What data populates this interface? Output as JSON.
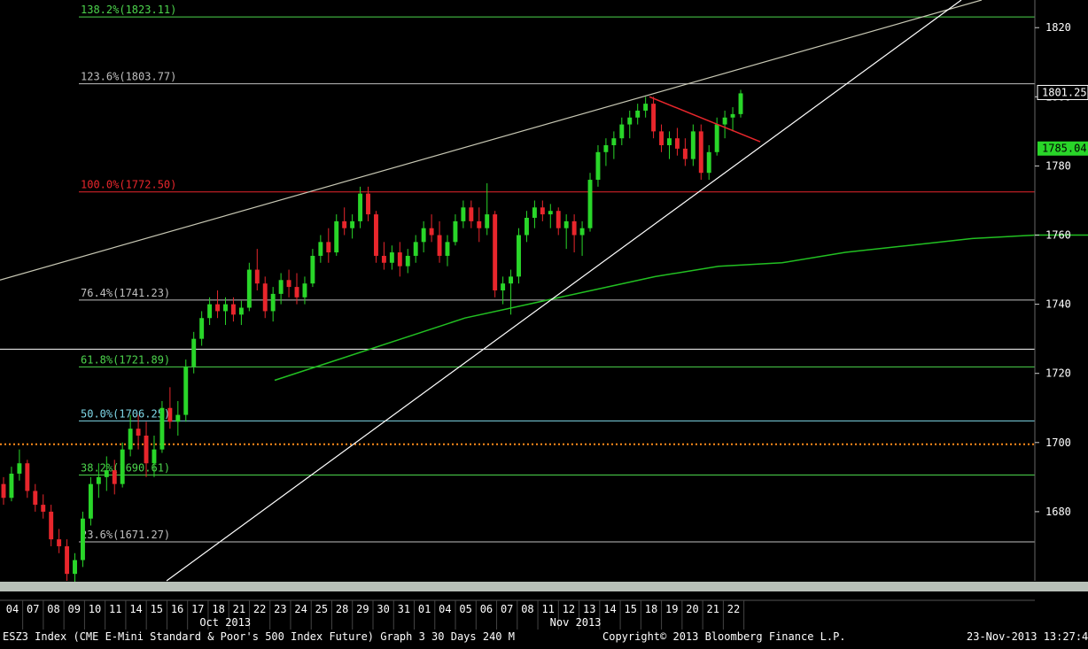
{
  "chart_data": {
    "type": "candlestick",
    "ylim": [
      1660,
      1828
    ],
    "y_ticks": [
      "1680",
      "1700",
      "1720",
      "1740",
      "1760",
      "1780",
      "1800",
      "1820"
    ],
    "grid": false,
    "x_dates": [
      "04",
      "07",
      "08",
      "09",
      "10",
      "11",
      "14",
      "15",
      "16",
      "17",
      "18",
      "21",
      "22",
      "23",
      "24",
      "25",
      "28",
      "29",
      "30",
      "31",
      "01",
      "04",
      "05",
      "06",
      "07",
      "08",
      "11",
      "12",
      "13",
      "14",
      "15",
      "18",
      "19",
      "20",
      "21",
      "22"
    ],
    "month_labels": [
      {
        "label": "Oct 2013",
        "start_index": 9
      },
      {
        "label": "Nov 2013",
        "start_index": 26
      }
    ],
    "fib_levels": [
      {
        "label": "138.2%(1823.11)",
        "value": 1823.11,
        "color": "#4cd44c"
      },
      {
        "label": "123.6%(1803.77)",
        "value": 1803.77,
        "color": "#bfbfbf"
      },
      {
        "label": "100.0%(1772.50)",
        "value": 1772.5,
        "color": "#e8262c"
      },
      {
        "label": "76.4%(1741.23)",
        "value": 1741.23,
        "color": "#bfbfbf"
      },
      {
        "label": "61.8%(1721.89)",
        "value": 1721.89,
        "color": "#4cd44c"
      },
      {
        "label": "50.0%(1706.25)",
        "value": 1706.25,
        "color": "#7fd8e8"
      },
      {
        "label": "38.2%(1690.61)",
        "value": 1690.61,
        "color": "#4cd44c"
      },
      {
        "label": "23.6%(1671.27)",
        "value": 1671.27,
        "color": "#bfbfbf"
      }
    ],
    "horizontal_levels": [
      {
        "value": 1727,
        "color": "#ffffff",
        "style": "solid"
      },
      {
        "value": 1699.5,
        "color": "#ff8c1a",
        "style": "dotted"
      }
    ],
    "current_price": {
      "label": "1801.25",
      "value": 1801.25
    },
    "moving_average_value": {
      "label": "1785.04",
      "value": 1785.04
    },
    "colors": {
      "up": "#29d629",
      "down": "#e8262c",
      "ma": "#22c022",
      "trend": "#ffffff",
      "channel": "#c8c8b4",
      "wedge": "#e8262c"
    },
    "candles": [
      [
        1688,
        1690,
        1682,
        1684
      ],
      [
        1684,
        1693,
        1683,
        1691
      ],
      [
        1691,
        1698,
        1689,
        1694
      ],
      [
        1694,
        1695,
        1684,
        1686
      ],
      [
        1686,
        1688,
        1680,
        1682
      ],
      [
        1682,
        1685,
        1678,
        1680
      ],
      [
        1680,
        1682,
        1670,
        1672
      ],
      [
        1672,
        1675,
        1668,
        1670
      ],
      [
        1670,
        1672,
        1660,
        1662
      ],
      [
        1662,
        1668,
        1658,
        1666
      ],
      [
        1666,
        1680,
        1664,
        1678
      ],
      [
        1678,
        1690,
        1676,
        1688
      ],
      [
        1688,
        1694,
        1684,
        1690
      ],
      [
        1690,
        1696,
        1686,
        1692
      ],
      [
        1692,
        1695,
        1685,
        1688
      ],
      [
        1688,
        1700,
        1687,
        1698
      ],
      [
        1698,
        1708,
        1696,
        1704
      ],
      [
        1704,
        1708,
        1698,
        1702
      ],
      [
        1702,
        1706,
        1690,
        1694
      ],
      [
        1694,
        1702,
        1690,
        1698
      ],
      [
        1698,
        1712,
        1697,
        1710
      ],
      [
        1710,
        1716,
        1704,
        1706
      ],
      [
        1706,
        1712,
        1702,
        1708
      ],
      [
        1708,
        1724,
        1706,
        1722
      ],
      [
        1722,
        1732,
        1720,
        1730
      ],
      [
        1730,
        1738,
        1728,
        1736
      ],
      [
        1736,
        1742,
        1734,
        1740
      ],
      [
        1740,
        1744,
        1736,
        1738
      ],
      [
        1738,
        1742,
        1734,
        1740
      ],
      [
        1740,
        1742,
        1735,
        1737
      ],
      [
        1737,
        1741,
        1734,
        1739
      ],
      [
        1739,
        1752,
        1738,
        1750
      ],
      [
        1750,
        1756,
        1744,
        1746
      ],
      [
        1746,
        1748,
        1736,
        1738
      ],
      [
        1738,
        1745,
        1735,
        1743
      ],
      [
        1743,
        1749,
        1740,
        1747
      ],
      [
        1747,
        1750,
        1742,
        1745
      ],
      [
        1745,
        1749,
        1740,
        1742
      ],
      [
        1742,
        1748,
        1740,
        1746
      ],
      [
        1746,
        1756,
        1745,
        1754
      ],
      [
        1754,
        1760,
        1752,
        1758
      ],
      [
        1758,
        1762,
        1752,
        1755
      ],
      [
        1755,
        1766,
        1754,
        1764
      ],
      [
        1764,
        1768,
        1760,
        1762
      ],
      [
        1762,
        1766,
        1759,
        1764
      ],
      [
        1764,
        1774,
        1762,
        1772
      ],
      [
        1772,
        1774,
        1764,
        1766
      ],
      [
        1766,
        1767,
        1752,
        1754
      ],
      [
        1754,
        1758,
        1750,
        1752
      ],
      [
        1752,
        1757,
        1750,
        1755
      ],
      [
        1755,
        1758,
        1748,
        1751
      ],
      [
        1751,
        1756,
        1749,
        1754
      ],
      [
        1754,
        1760,
        1752,
        1758
      ],
      [
        1758,
        1764,
        1755,
        1762
      ],
      [
        1762,
        1766,
        1758,
        1760
      ],
      [
        1760,
        1764,
        1752,
        1754
      ],
      [
        1754,
        1760,
        1751,
        1758
      ],
      [
        1758,
        1766,
        1757,
        1764
      ],
      [
        1764,
        1770,
        1762,
        1768
      ],
      [
        1768,
        1770,
        1762,
        1764
      ],
      [
        1764,
        1768,
        1758,
        1762
      ],
      [
        1762,
        1775,
        1760,
        1766
      ],
      [
        1766,
        1767,
        1742,
        1744
      ],
      [
        1744,
        1748,
        1740,
        1746
      ],
      [
        1746,
        1750,
        1737,
        1748
      ],
      [
        1748,
        1762,
        1746,
        1760
      ],
      [
        1760,
        1767,
        1758,
        1765
      ],
      [
        1765,
        1770,
        1762,
        1768
      ],
      [
        1768,
        1770,
        1764,
        1766
      ],
      [
        1766,
        1769,
        1762,
        1767
      ],
      [
        1767,
        1768,
        1760,
        1762
      ],
      [
        1762,
        1766,
        1756,
        1764
      ],
      [
        1764,
        1766,
        1755,
        1760
      ],
      [
        1760,
        1764,
        1754,
        1762
      ],
      [
        1762,
        1778,
        1761,
        1776
      ],
      [
        1776,
        1786,
        1774,
        1784
      ],
      [
        1784,
        1788,
        1780,
        1786
      ],
      [
        1786,
        1790,
        1782,
        1788
      ],
      [
        1788,
        1794,
        1786,
        1792
      ],
      [
        1792,
        1796,
        1788,
        1794
      ],
      [
        1794,
        1798,
        1792,
        1796
      ],
      [
        1796,
        1800,
        1794,
        1798
      ],
      [
        1798,
        1800,
        1788,
        1790
      ],
      [
        1790,
        1792,
        1784,
        1786
      ],
      [
        1786,
        1790,
        1782,
        1788
      ],
      [
        1788,
        1791,
        1783,
        1785
      ],
      [
        1785,
        1788,
        1780,
        1782
      ],
      [
        1782,
        1792,
        1780,
        1790
      ],
      [
        1790,
        1792,
        1776,
        1778
      ],
      [
        1778,
        1786,
        1776,
        1784
      ],
      [
        1784,
        1794,
        1783,
        1792
      ],
      [
        1792,
        1796,
        1788,
        1794
      ],
      [
        1794,
        1797,
        1790,
        1795
      ],
      [
        1795,
        1802,
        1794,
        1801
      ]
    ],
    "ma_points": [
      [
        1718,
        18
      ],
      [
        1724,
        20
      ],
      [
        1730,
        22
      ],
      [
        1736,
        24
      ],
      [
        1740,
        26
      ],
      [
        1744,
        28
      ],
      [
        1748,
        30
      ],
      [
        1751,
        32
      ],
      [
        1752,
        34
      ],
      [
        1755,
        36
      ],
      [
        1757,
        38
      ],
      [
        1759,
        40
      ],
      [
        1760,
        42
      ],
      [
        1760,
        44
      ],
      [
        1761,
        46
      ],
      [
        1762,
        48
      ],
      [
        1765,
        50
      ],
      [
        1770,
        52
      ],
      [
        1775,
        54
      ],
      [
        1778,
        56
      ],
      [
        1781,
        58
      ],
      [
        1783,
        60
      ],
      [
        1785,
        62
      ]
    ]
  }
}
